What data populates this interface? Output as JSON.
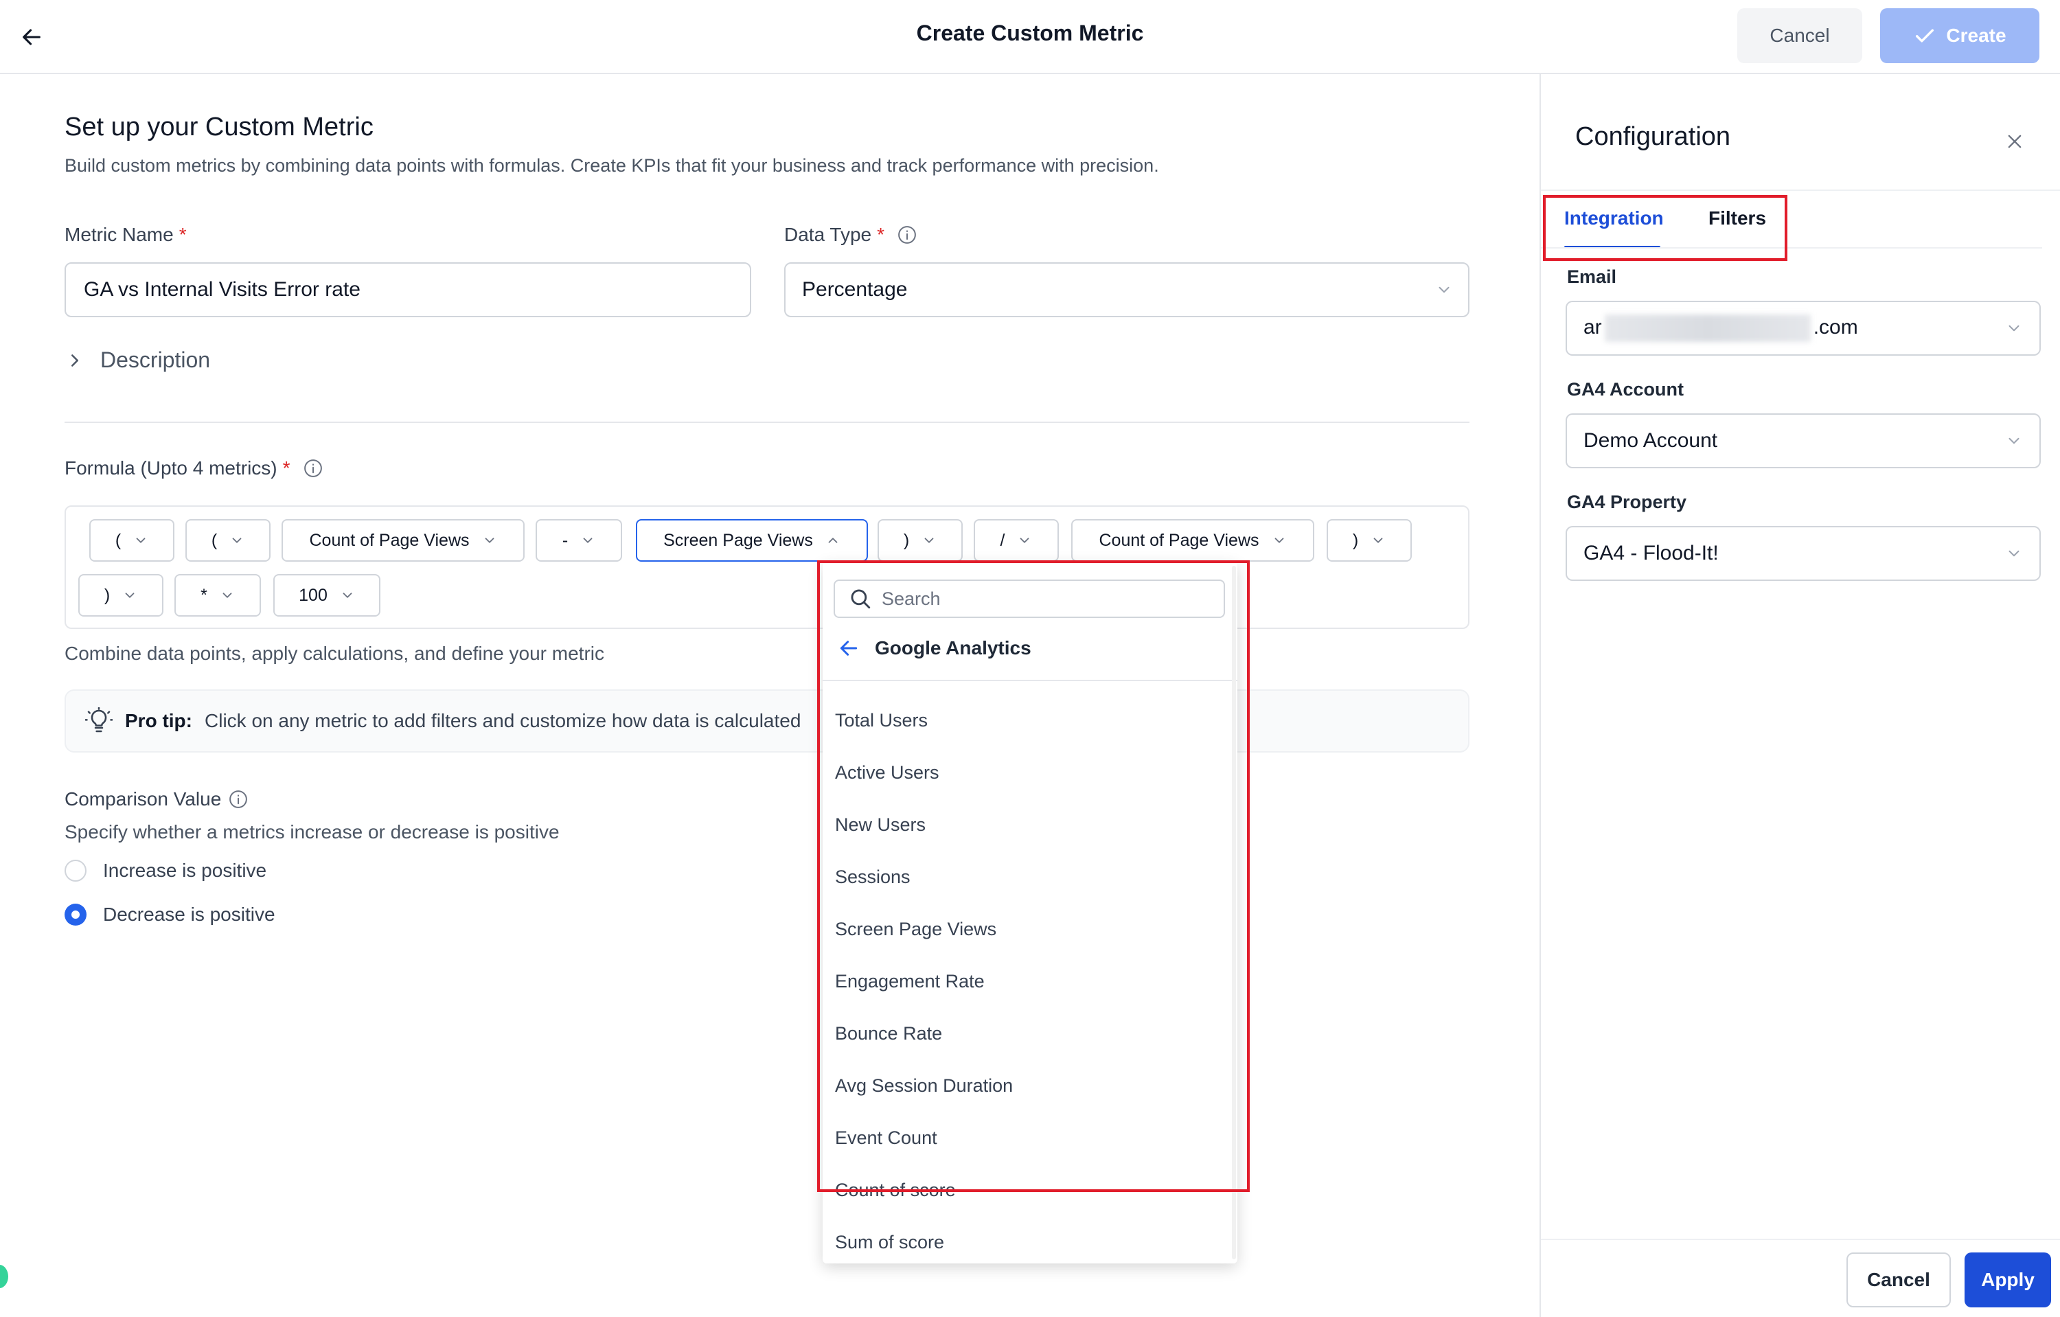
{
  "header": {
    "title": "Create Custom Metric",
    "cancel_label": "Cancel",
    "create_label": "Create"
  },
  "setup": {
    "title": "Set up your Custom Metric",
    "subtitle": "Build custom metrics by combining data points with formulas. Create KPIs that fit your business and track performance with precision."
  },
  "metric_name": {
    "label": "Metric Name",
    "required_mark": "*",
    "value": "GA vs Internal Visits Error rate"
  },
  "data_type": {
    "label": "Data Type",
    "required_mark": "*",
    "value": "Percentage"
  },
  "description": {
    "label": "Description"
  },
  "formula": {
    "label": "Formula (Upto 4 metrics)",
    "required_mark": "*",
    "tokens": [
      "(",
      "(",
      "Count of Page Views",
      "-",
      "Screen Page Views",
      ")",
      "/",
      "Count of Page Views",
      ")",
      ")",
      "*",
      "100"
    ],
    "help": "Combine data points, apply calculations, and define your metric"
  },
  "protip": {
    "label": "Pro tip:",
    "text": "Click on any metric to add filters and customize how data is calculated"
  },
  "comparison": {
    "title": "Comparison Value",
    "subtitle": "Specify whether a metrics increase or decrease is positive",
    "options": [
      {
        "label": "Increase is positive",
        "checked": false
      },
      {
        "label": "Decrease is positive",
        "checked": true
      }
    ]
  },
  "dropdown": {
    "search_placeholder": "Search",
    "source": "Google Analytics",
    "items": [
      "Total Users",
      "Active Users",
      "New Users",
      "Sessions",
      "Screen Page Views",
      "Engagement Rate",
      "Bounce Rate",
      "Avg Session Duration",
      "Event Count",
      "Count of score",
      "Sum of score"
    ]
  },
  "config": {
    "title": "Configuration",
    "tabs": [
      "Integration",
      "Filters"
    ],
    "active_tab": "Integration",
    "email": {
      "label": "Email",
      "value_prefix": "ar",
      "value_suffix": ".com"
    },
    "account": {
      "label": "GA4 Account",
      "value": "Demo Account"
    },
    "property": {
      "label": "GA4 Property",
      "value": "GA4 - Flood-It!"
    },
    "cancel_label": "Cancel",
    "apply_label": "Apply"
  },
  "colors": {
    "primary": "#1d4ed8",
    "primary_disabled": "#9db8f7",
    "required": "#dc2626",
    "annotation": "#e11d2b"
  }
}
